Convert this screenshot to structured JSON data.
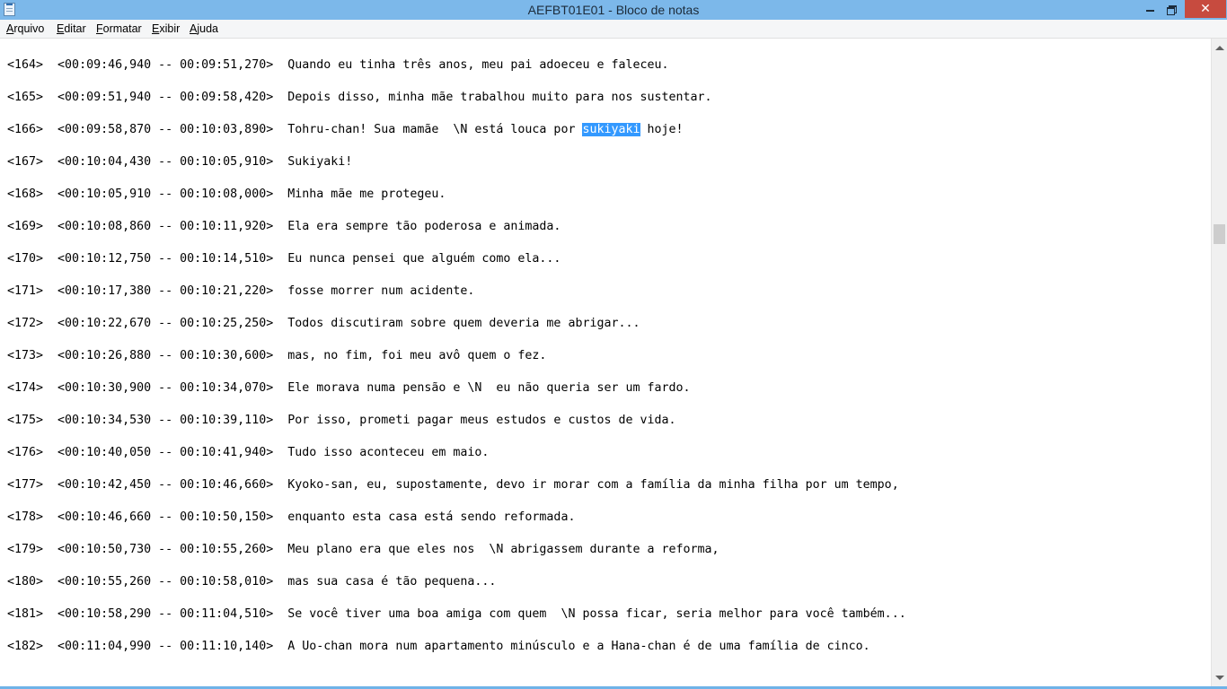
{
  "window": {
    "title": "AEFBT01E01 - Bloco de notas"
  },
  "controls": {
    "close_glyph": "✕"
  },
  "menu": [
    {
      "acc": "A",
      "rest": "rquivo"
    },
    {
      "acc": "E",
      "rest": "ditar"
    },
    {
      "acc": "F",
      "rest": "ormatar"
    },
    {
      "acc": "E",
      "rest": "xibir"
    },
    {
      "acc": "A",
      "rest": "juda"
    }
  ],
  "lines": [
    {
      "num": "<164>",
      "time": "<00:09:46,940 -- 00:09:51,270>",
      "text": "Quando eu tinha três anos, meu pai adoeceu e faleceu."
    },
    {
      "num": "<165>",
      "time": "<00:09:51,940 -- 00:09:58,420>",
      "text": "Depois disso, minha mãe trabalhou muito para nos sustentar."
    },
    {
      "num": "<166>",
      "time": "<00:09:58,870 -- 00:10:03,890>",
      "text_before": "Tohru-chan! Sua mamãe  \\N está louca por ",
      "text_selected": "sukiyaki",
      "text_after": " hoje!"
    },
    {
      "num": "<167>",
      "time": "<00:10:04,430 -- 00:10:05,910>",
      "text": "Sukiyaki!"
    },
    {
      "num": "<168>",
      "time": "<00:10:05,910 -- 00:10:08,000>",
      "text": "Minha mãe me protegeu."
    },
    {
      "num": "<169>",
      "time": "<00:10:08,860 -- 00:10:11,920>",
      "text": "Ela era sempre tão poderosa e animada."
    },
    {
      "num": "<170>",
      "time": "<00:10:12,750 -- 00:10:14,510>",
      "text": "Eu nunca pensei que alguém como ela..."
    },
    {
      "num": "<171>",
      "time": "<00:10:17,380 -- 00:10:21,220>",
      "text": "fosse morrer num acidente."
    },
    {
      "num": "<172>",
      "time": "<00:10:22,670 -- 00:10:25,250>",
      "text": "Todos discutiram sobre quem deveria me abrigar..."
    },
    {
      "num": "<173>",
      "time": "<00:10:26,880 -- 00:10:30,600>",
      "text": "mas, no fim, foi meu avô quem o fez."
    },
    {
      "num": "<174>",
      "time": "<00:10:30,900 -- 00:10:34,070>",
      "text": "Ele morava numa pensão e \\N  eu não queria ser um fardo."
    },
    {
      "num": "<175>",
      "time": "<00:10:34,530 -- 00:10:39,110>",
      "text": "Por isso, prometi pagar meus estudos e custos de vida."
    },
    {
      "num": "<176>",
      "time": "<00:10:40,050 -- 00:10:41,940>",
      "text": "Tudo isso aconteceu em maio."
    },
    {
      "num": "<177>",
      "time": "<00:10:42,450 -- 00:10:46,660>",
      "text": "Kyoko-san, eu, supostamente, devo ir morar com a família da minha filha por um tempo,"
    },
    {
      "num": "<178>",
      "time": "<00:10:46,660 -- 00:10:50,150>",
      "text": "enquanto esta casa está sendo reformada."
    },
    {
      "num": "<179>",
      "time": "<00:10:50,730 -- 00:10:55,260>",
      "text": "Meu plano era que eles nos  \\N abrigassem durante a reforma,"
    },
    {
      "num": "<180>",
      "time": "<00:10:55,260 -- 00:10:58,010>",
      "text": "mas sua casa é tão pequena..."
    },
    {
      "num": "<181>",
      "time": "<00:10:58,290 -- 00:11:04,510>",
      "text": "Se você tiver uma boa amiga com quem  \\N possa ficar, seria melhor para você também..."
    },
    {
      "num": "<182>",
      "time": "<00:11:04,990 -- 00:11:10,140>",
      "text": "A Uo-chan mora num apartamento minúsculo e a Hana-chan é de uma família de cinco."
    }
  ]
}
